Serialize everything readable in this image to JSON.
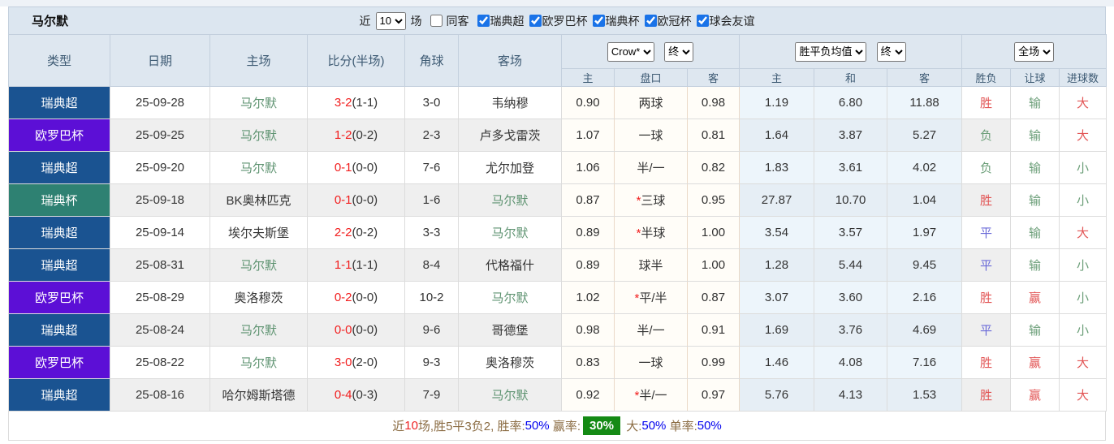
{
  "header": {
    "title": "马尔默",
    "filter": {
      "near_label": "近",
      "matches_value": "10",
      "games_label": "场",
      "same_venue_label": "同客",
      "same_venue_checked": false,
      "leagues": [
        {
          "label": "瑞典超",
          "checked": true
        },
        {
          "label": "欧罗巴杯",
          "checked": true
        },
        {
          "label": "瑞典杯",
          "checked": true
        },
        {
          "label": "欧冠杯",
          "checked": true
        },
        {
          "label": "球会友谊",
          "checked": true
        }
      ]
    }
  },
  "table": {
    "head": {
      "type": "类型",
      "date": "日期",
      "home": "主场",
      "score": "比分(半场)",
      "corner": "角球",
      "away": "客场",
      "sub": {
        "home": "主",
        "line": "盘口",
        "away": "客",
        "avg_home": "主",
        "avg_draw": "和",
        "avg_away": "客",
        "result": "胜负",
        "handicap": "让球",
        "goals": "进球数"
      }
    },
    "selects": {
      "bookmaker": "Crow*",
      "bookmaker_time": "终",
      "avg": "胜平负均值",
      "avg_time": "终",
      "scope": "全场"
    },
    "league_colors": {
      "瑞典超": "#1a5391",
      "欧罗巴杯": "#5c0fd6",
      "瑞典杯": "#2e8172"
    },
    "result_colors": {
      "胜": "t-red",
      "负": "t-green",
      "平": "t-blue",
      "赢": "t-red",
      "输": "t-green",
      "大": "t-red",
      "小": "t-green"
    },
    "rows": [
      {
        "league": "瑞典超",
        "date": "25-09-28",
        "home": "马尔默",
        "home_self": true,
        "score": "3-2",
        "half": "(1-1)",
        "corner": "3-0",
        "away": "韦纳穆",
        "away_self": false,
        "ah_home": "0.90",
        "ah_line": "两球",
        "ah_star": false,
        "ah_away": "0.98",
        "avg_home": "1.19",
        "avg_draw": "6.80",
        "avg_away": "11.88",
        "result": "胜",
        "handicap": "输",
        "goals": "大"
      },
      {
        "league": "欧罗巴杯",
        "date": "25-09-25",
        "home": "马尔默",
        "home_self": true,
        "score": "1-2",
        "half": "(0-2)",
        "corner": "2-3",
        "away": "卢多戈雷茨",
        "away_self": false,
        "ah_home": "1.07",
        "ah_line": "一球",
        "ah_star": false,
        "ah_away": "0.81",
        "avg_home": "1.64",
        "avg_draw": "3.87",
        "avg_away": "5.27",
        "result": "负",
        "handicap": "输",
        "goals": "大"
      },
      {
        "league": "瑞典超",
        "date": "25-09-20",
        "home": "马尔默",
        "home_self": true,
        "score": "0-1",
        "half": "(0-0)",
        "corner": "7-6",
        "away": "尤尔加登",
        "away_self": false,
        "ah_home": "1.06",
        "ah_line": "半/一",
        "ah_star": false,
        "ah_away": "0.82",
        "avg_home": "1.83",
        "avg_draw": "3.61",
        "avg_away": "4.02",
        "result": "负",
        "handicap": "输",
        "goals": "小"
      },
      {
        "league": "瑞典杯",
        "date": "25-09-18",
        "home": "BK奥林匹克",
        "home_self": false,
        "score": "0-1",
        "half": "(0-0)",
        "corner": "1-6",
        "away": "马尔默",
        "away_self": true,
        "ah_home": "0.87",
        "ah_line": "三球",
        "ah_star": true,
        "ah_away": "0.95",
        "avg_home": "27.87",
        "avg_draw": "10.70",
        "avg_away": "1.04",
        "result": "胜",
        "handicap": "输",
        "goals": "小"
      },
      {
        "league": "瑞典超",
        "date": "25-09-14",
        "home": "埃尔夫斯堡",
        "home_self": false,
        "score": "2-2",
        "half": "(0-2)",
        "corner": "3-3",
        "away": "马尔默",
        "away_self": true,
        "ah_home": "0.89",
        "ah_line": "半球",
        "ah_star": true,
        "ah_away": "1.00",
        "avg_home": "3.54",
        "avg_draw": "3.57",
        "avg_away": "1.97",
        "result": "平",
        "handicap": "输",
        "goals": "大"
      },
      {
        "league": "瑞典超",
        "date": "25-08-31",
        "home": "马尔默",
        "home_self": true,
        "score": "1-1",
        "half": "(1-1)",
        "corner": "8-4",
        "away": "代格福什",
        "away_self": false,
        "ah_home": "0.89",
        "ah_line": "球半",
        "ah_star": false,
        "ah_away": "1.00",
        "avg_home": "1.28",
        "avg_draw": "5.44",
        "avg_away": "9.45",
        "result": "平",
        "handicap": "输",
        "goals": "小"
      },
      {
        "league": "欧罗巴杯",
        "date": "25-08-29",
        "home": "奥洛穆茨",
        "home_self": false,
        "score": "0-2",
        "half": "(0-0)",
        "corner": "10-2",
        "away": "马尔默",
        "away_self": true,
        "ah_home": "1.02",
        "ah_line": "平/半",
        "ah_star": true,
        "ah_away": "0.87",
        "avg_home": "3.07",
        "avg_draw": "3.60",
        "avg_away": "2.16",
        "result": "胜",
        "handicap": "赢",
        "goals": "小"
      },
      {
        "league": "瑞典超",
        "date": "25-08-24",
        "home": "马尔默",
        "home_self": true,
        "score": "0-0",
        "half": "(0-0)",
        "corner": "9-6",
        "away": "哥德堡",
        "away_self": false,
        "ah_home": "0.98",
        "ah_line": "半/一",
        "ah_star": false,
        "ah_away": "0.91",
        "avg_home": "1.69",
        "avg_draw": "3.76",
        "avg_away": "4.69",
        "result": "平",
        "handicap": "输",
        "goals": "小"
      },
      {
        "league": "欧罗巴杯",
        "date": "25-08-22",
        "home": "马尔默",
        "home_self": true,
        "score": "3-0",
        "half": "(2-0)",
        "corner": "9-3",
        "away": "奥洛穆茨",
        "away_self": false,
        "ah_home": "0.83",
        "ah_line": "一球",
        "ah_star": false,
        "ah_away": "0.99",
        "avg_home": "1.46",
        "avg_draw": "4.08",
        "avg_away": "7.16",
        "result": "胜",
        "handicap": "赢",
        "goals": "大"
      },
      {
        "league": "瑞典超",
        "date": "25-08-16",
        "home": "哈尔姆斯塔德",
        "home_self": false,
        "score": "0-4",
        "half": "(0-3)",
        "corner": "7-9",
        "away": "马尔默",
        "away_self": true,
        "ah_home": "0.92",
        "ah_line": "半/一",
        "ah_star": true,
        "ah_away": "0.97",
        "avg_home": "5.76",
        "avg_draw": "4.13",
        "avg_away": "1.53",
        "result": "胜",
        "handicap": "赢",
        "goals": "大"
      }
    ]
  },
  "footer": {
    "segments": [
      {
        "text": "近",
        "cls": "brown"
      },
      {
        "text": "10",
        "cls": "red"
      },
      {
        "text": "场,胜5平3负2, 胜率:",
        "cls": "brown"
      },
      {
        "text": "50%",
        "cls": "blue"
      },
      {
        "text": " 赢率:",
        "cls": "brown"
      },
      {
        "text": "30%",
        "cls": "badge-green"
      },
      {
        "text": " 大:",
        "cls": "brown"
      },
      {
        "text": "50%",
        "cls": "blue"
      },
      {
        "text": " 单率:",
        "cls": "brown"
      },
      {
        "text": "50%",
        "cls": "blue"
      }
    ]
  }
}
